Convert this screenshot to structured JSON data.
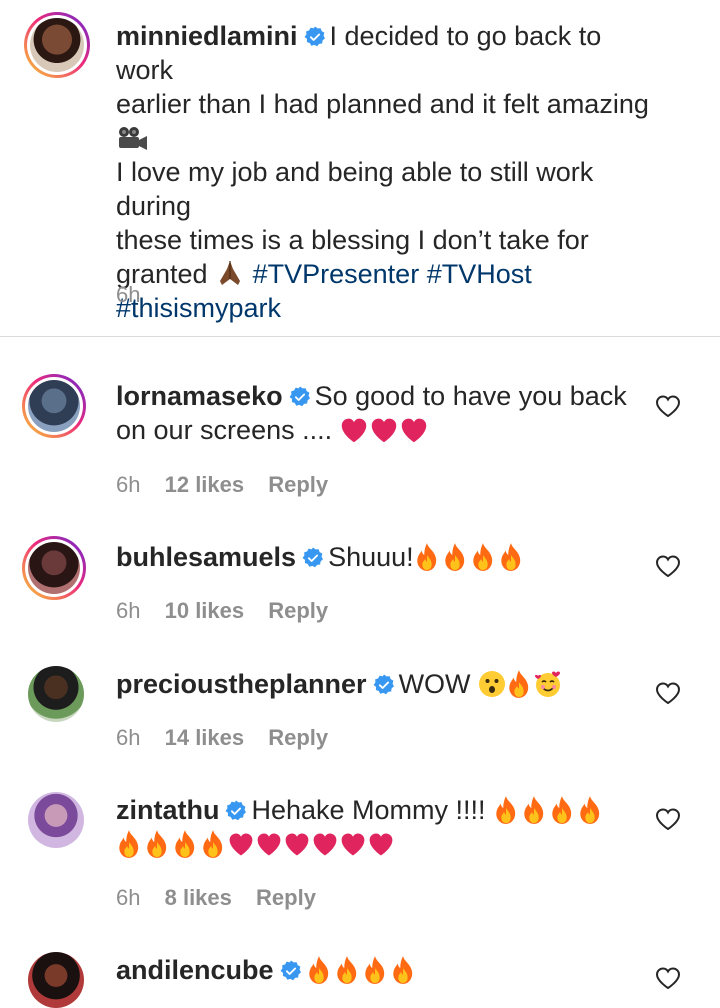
{
  "caption": {
    "username": "minniedlamini",
    "line1": "I decided to go back to work",
    "line2": "earlier than I had planned and it felt amazing",
    "line4": "I love my job and being able to still work during",
    "line5": "these times is a blessing I don’t take for",
    "line6_prefix": "granted",
    "hashtags": [
      "#TVPresenter",
      "#TVHost",
      "#thisismypark"
    ],
    "time": "6h"
  },
  "comments": [
    {
      "username": "lornamaseko",
      "text1": "So good to have you back",
      "text2": "on our screens ....",
      "time": "6h",
      "likes": "12 likes",
      "reply": "Reply"
    },
    {
      "username": "buhlesamuels",
      "text1": "Shuuu!",
      "time": "6h",
      "likes": "10 likes",
      "reply": "Reply"
    },
    {
      "username": "precioustheplanner",
      "text1": "WOW",
      "time": "6h",
      "likes": "14 likes",
      "reply": "Reply"
    },
    {
      "username": "zintathu",
      "text1": "Hehake Mommy !!!!",
      "time": "6h",
      "likes": "8 likes",
      "reply": "Reply"
    },
    {
      "username": "andilencube"
    }
  ],
  "colors": {
    "hashtag": "#00376b",
    "verified": "#3897f0",
    "meta": "#8e8e8e",
    "fire": "#ff7a1a",
    "heart": "#e0245e"
  }
}
